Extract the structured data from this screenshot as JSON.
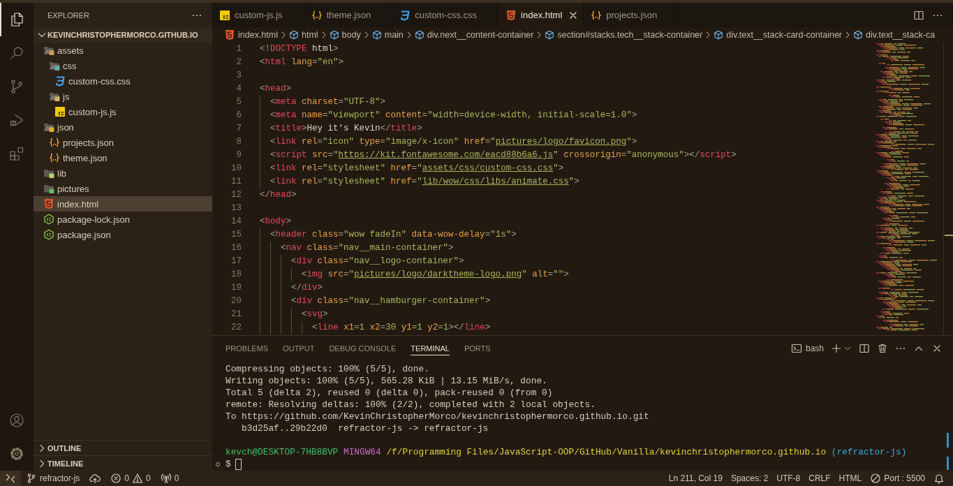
{
  "activity_bar": {
    "items": [
      {
        "kind": "files",
        "selected": true
      },
      {
        "kind": "search",
        "selected": false
      },
      {
        "kind": "source-control",
        "selected": false
      },
      {
        "kind": "run-debug",
        "selected": false
      },
      {
        "kind": "extensions",
        "selected": false
      }
    ],
    "bottom_items": [
      {
        "kind": "account"
      },
      {
        "kind": "settings"
      }
    ]
  },
  "sidebar": {
    "title": "EXPLORER",
    "root": {
      "label": "KEVINCHRISTOPHERMORCO.GITHUB.IO",
      "expanded": true,
      "children": [
        {
          "label": "assets",
          "kind": "folder-assets",
          "expanded": true,
          "selected": false,
          "children": [
            {
              "label": "css",
              "kind": "folder-css",
              "expanded": true,
              "selected": false,
              "children": [
                {
                  "label": "custom-css.css",
                  "kind": "css",
                  "selected": false
                }
              ]
            },
            {
              "label": "js",
              "kind": "folder-js",
              "expanded": true,
              "selected": false,
              "children": [
                {
                  "label": "custom-js.js",
                  "kind": "js",
                  "selected": false
                }
              ]
            }
          ]
        },
        {
          "label": "json",
          "kind": "folder-json",
          "expanded": true,
          "selected": false,
          "children": [
            {
              "label": "projects.json",
              "kind": "json",
              "selected": false
            },
            {
              "label": "theme.json",
              "kind": "json",
              "selected": false
            }
          ]
        },
        {
          "label": "lib",
          "kind": "folder-lib",
          "expanded": false,
          "selected": false
        },
        {
          "label": "pictures",
          "kind": "folder-images",
          "expanded": false,
          "selected": false
        },
        {
          "label": "index.html",
          "kind": "html",
          "selected": true
        },
        {
          "label": "package-lock.json",
          "kind": "npm",
          "selected": false
        },
        {
          "label": "package.json",
          "kind": "npm",
          "selected": false
        }
      ]
    },
    "sections": [
      {
        "label": "OUTLINE",
        "expanded": false
      },
      {
        "label": "TIMELINE",
        "expanded": false
      }
    ]
  },
  "tabs": [
    {
      "label": "custom-js.js",
      "kind": "js",
      "selected": false
    },
    {
      "label": "theme.json",
      "kind": "json",
      "selected": false
    },
    {
      "label": "custom-css.css",
      "kind": "css",
      "selected": false
    },
    {
      "label": "index.html",
      "kind": "html",
      "selected": true
    },
    {
      "label": "projects.json",
      "kind": "json",
      "selected": false
    }
  ],
  "breadcrumbs": [
    {
      "label": "index.html",
      "kind": "html"
    },
    {
      "label": "html",
      "kind": "element"
    },
    {
      "label": "body",
      "kind": "element"
    },
    {
      "label": "main",
      "kind": "element"
    },
    {
      "label": "div.next__content-container",
      "kind": "element"
    },
    {
      "label": "section#stacks.tech__stack-container",
      "kind": "element"
    },
    {
      "label": "div.text__stack-card-container",
      "kind": "element"
    },
    {
      "label": "div.text__stack-ca",
      "kind": "element"
    }
  ],
  "editor": {
    "lines": [
      {
        "number": "1",
        "tokens": [
          {
            "kind": "punct",
            "text": "<!"
          },
          {
            "kind": "tag",
            "text": "DOCTYPE"
          },
          {
            "kind": "text",
            "text": " html"
          },
          {
            "kind": "punct",
            "text": ">"
          }
        ]
      },
      {
        "number": "2",
        "tokens": [
          {
            "kind": "punct",
            "text": "<"
          },
          {
            "kind": "tag",
            "text": "html"
          },
          {
            "kind": "attr",
            "text": " lang"
          },
          {
            "kind": "punct",
            "text": "="
          },
          {
            "kind": "string",
            "text": "\"en\""
          },
          {
            "kind": "punct",
            "text": ">"
          }
        ]
      },
      {
        "number": "3"
      },
      {
        "number": "4",
        "tokens": [
          {
            "kind": "punct",
            "text": "<"
          },
          {
            "kind": "tag",
            "text": "head"
          },
          {
            "kind": "punct",
            "text": ">"
          }
        ]
      },
      {
        "number": "5",
        "tokens": [
          {
            "kind": "punct",
            "text": "  <"
          },
          {
            "kind": "tag",
            "text": "meta"
          },
          {
            "kind": "attr",
            "text": " charset"
          },
          {
            "kind": "punct",
            "text": "="
          },
          {
            "kind": "string",
            "text": "\"UTF-8\""
          },
          {
            "kind": "punct",
            "text": ">"
          }
        ]
      },
      {
        "number": "6",
        "tokens": [
          {
            "kind": "punct",
            "text": "  <"
          },
          {
            "kind": "tag",
            "text": "meta"
          },
          {
            "kind": "attr",
            "text": " name"
          },
          {
            "kind": "punct",
            "text": "="
          },
          {
            "kind": "string",
            "text": "\"viewport\""
          },
          {
            "kind": "attr",
            "text": " content"
          },
          {
            "kind": "punct",
            "text": "="
          },
          {
            "kind": "string",
            "text": "\"width=device-width, initial-scale=1.0\""
          },
          {
            "kind": "punct",
            "text": ">"
          }
        ]
      },
      {
        "number": "7",
        "tokens": [
          {
            "kind": "punct",
            "text": "  <"
          },
          {
            "kind": "tag",
            "text": "title"
          },
          {
            "kind": "punct",
            "text": ">"
          },
          {
            "kind": "text",
            "text": "Hey it's Kevin"
          },
          {
            "kind": "punct",
            "text": "</"
          },
          {
            "kind": "tag",
            "text": "title"
          },
          {
            "kind": "punct",
            "text": ">"
          }
        ]
      },
      {
        "number": "8",
        "tokens": [
          {
            "kind": "punct",
            "text": "  <"
          },
          {
            "kind": "tag",
            "text": "link"
          },
          {
            "kind": "attr",
            "text": " rel"
          },
          {
            "kind": "punct",
            "text": "="
          },
          {
            "kind": "string",
            "text": "\"icon\""
          },
          {
            "kind": "attr",
            "text": " type"
          },
          {
            "kind": "punct",
            "text": "="
          },
          {
            "kind": "string",
            "text": "\"image/x-icon\""
          },
          {
            "kind": "attr",
            "text": " href"
          },
          {
            "kind": "punct",
            "text": "="
          },
          {
            "kind": "string",
            "text": "\""
          },
          {
            "kind": "link",
            "text": "pictures/logo/favicon.png"
          },
          {
            "kind": "string",
            "text": "\""
          },
          {
            "kind": "punct",
            "text": ">"
          }
        ]
      },
      {
        "number": "9",
        "tokens": [
          {
            "kind": "punct",
            "text": "  <"
          },
          {
            "kind": "tag",
            "text": "script"
          },
          {
            "kind": "attr",
            "text": " src"
          },
          {
            "kind": "punct",
            "text": "="
          },
          {
            "kind": "string",
            "text": "\""
          },
          {
            "kind": "link",
            "text": "https://kit.fontawesome.com/eacd88b6a6.js"
          },
          {
            "kind": "string",
            "text": "\""
          },
          {
            "kind": "attr",
            "text": " crossorigin"
          },
          {
            "kind": "punct",
            "text": "="
          },
          {
            "kind": "string",
            "text": "\"anonymous\""
          },
          {
            "kind": "punct",
            "text": "></"
          },
          {
            "kind": "tag",
            "text": "script"
          },
          {
            "kind": "punct",
            "text": ">"
          }
        ]
      },
      {
        "number": "10",
        "tokens": [
          {
            "kind": "punct",
            "text": "  <"
          },
          {
            "kind": "tag",
            "text": "link"
          },
          {
            "kind": "attr",
            "text": " rel"
          },
          {
            "kind": "punct",
            "text": "="
          },
          {
            "kind": "string",
            "text": "\"stylesheet\""
          },
          {
            "kind": "attr",
            "text": " href"
          },
          {
            "kind": "punct",
            "text": "="
          },
          {
            "kind": "string",
            "text": "\""
          },
          {
            "kind": "link",
            "text": "assets/css/custom-css.css"
          },
          {
            "kind": "string",
            "text": "\""
          },
          {
            "kind": "punct",
            "text": ">"
          }
        ]
      },
      {
        "number": "11",
        "tokens": [
          {
            "kind": "punct",
            "text": "  <"
          },
          {
            "kind": "tag",
            "text": "link"
          },
          {
            "kind": "attr",
            "text": " rel"
          },
          {
            "kind": "punct",
            "text": "="
          },
          {
            "kind": "string",
            "text": "\"stylesheet\""
          },
          {
            "kind": "attr",
            "text": " href"
          },
          {
            "kind": "punct",
            "text": "="
          },
          {
            "kind": "string",
            "text": "\""
          },
          {
            "kind": "link",
            "text": "lib/wow/css/libs/animate.css"
          },
          {
            "kind": "string",
            "text": "\""
          },
          {
            "kind": "punct",
            "text": ">"
          }
        ]
      },
      {
        "number": "12",
        "tokens": [
          {
            "kind": "punct",
            "text": "</"
          },
          {
            "kind": "tag",
            "text": "head"
          },
          {
            "kind": "punct",
            "text": ">"
          }
        ]
      },
      {
        "number": "13"
      },
      {
        "number": "14",
        "tokens": [
          {
            "kind": "punct",
            "text": "<"
          },
          {
            "kind": "tag",
            "text": "body"
          },
          {
            "kind": "punct",
            "text": ">"
          }
        ]
      },
      {
        "number": "15",
        "tokens": [
          {
            "kind": "punct",
            "text": "  <"
          },
          {
            "kind": "tag",
            "text": "header"
          },
          {
            "kind": "attr",
            "text": " class"
          },
          {
            "kind": "punct",
            "text": "="
          },
          {
            "kind": "string",
            "text": "\"wow fadeIn\""
          },
          {
            "kind": "attr",
            "text": " data-wow-delay"
          },
          {
            "kind": "punct",
            "text": "="
          },
          {
            "kind": "string",
            "text": "\"1s\""
          },
          {
            "kind": "punct",
            "text": ">"
          }
        ]
      },
      {
        "number": "16",
        "tokens": [
          {
            "kind": "punct",
            "text": "    <"
          },
          {
            "kind": "tag",
            "text": "nav"
          },
          {
            "kind": "attr",
            "text": " class"
          },
          {
            "kind": "punct",
            "text": "="
          },
          {
            "kind": "string",
            "text": "\"nav__main-container\""
          },
          {
            "kind": "punct",
            "text": ">"
          }
        ]
      },
      {
        "number": "17",
        "tokens": [
          {
            "kind": "punct",
            "text": "      <"
          },
          {
            "kind": "tag",
            "text": "div"
          },
          {
            "kind": "attr",
            "text": " class"
          },
          {
            "kind": "punct",
            "text": "="
          },
          {
            "kind": "string",
            "text": "\"nav__logo-container\""
          },
          {
            "kind": "punct",
            "text": ">"
          }
        ]
      },
      {
        "number": "18",
        "tokens": [
          {
            "kind": "punct",
            "text": "        <"
          },
          {
            "kind": "tag",
            "text": "img"
          },
          {
            "kind": "attr",
            "text": " src"
          },
          {
            "kind": "punct",
            "text": "="
          },
          {
            "kind": "string",
            "text": "\""
          },
          {
            "kind": "link",
            "text": "pictures/logo/darktheme-logo.png"
          },
          {
            "kind": "string",
            "text": "\""
          },
          {
            "kind": "attr",
            "text": " alt"
          },
          {
            "kind": "punct",
            "text": "="
          },
          {
            "kind": "string",
            "text": "\"\""
          },
          {
            "kind": "punct",
            "text": ">"
          }
        ]
      },
      {
        "number": "19",
        "tokens": [
          {
            "kind": "punct",
            "text": "      </"
          },
          {
            "kind": "tag",
            "text": "div"
          },
          {
            "kind": "punct",
            "text": ">"
          }
        ]
      },
      {
        "number": "20",
        "tokens": [
          {
            "kind": "punct",
            "text": "      <"
          },
          {
            "kind": "tag",
            "text": "div"
          },
          {
            "kind": "attr",
            "text": " class"
          },
          {
            "kind": "punct",
            "text": "="
          },
          {
            "kind": "string",
            "text": "\"nav__hamburger-container\""
          },
          {
            "kind": "punct",
            "text": ">"
          }
        ]
      },
      {
        "number": "21",
        "tokens": [
          {
            "kind": "punct",
            "text": "        <"
          },
          {
            "kind": "tag",
            "text": "svg"
          },
          {
            "kind": "punct",
            "text": ">"
          }
        ]
      },
      {
        "number": "22",
        "tokens": [
          {
            "kind": "punct",
            "text": "          <"
          },
          {
            "kind": "tag",
            "text": "line"
          },
          {
            "kind": "attr",
            "text": " x1"
          },
          {
            "kind": "punct",
            "text": "="
          },
          {
            "kind": "string",
            "text": "1"
          },
          {
            "kind": "attr",
            "text": " x2"
          },
          {
            "kind": "punct",
            "text": "="
          },
          {
            "kind": "string",
            "text": "30"
          },
          {
            "kind": "attr",
            "text": " y1"
          },
          {
            "kind": "punct",
            "text": "="
          },
          {
            "kind": "string",
            "text": "1"
          },
          {
            "kind": "attr",
            "text": " y2"
          },
          {
            "kind": "punct",
            "text": "="
          },
          {
            "kind": "string",
            "text": "1"
          },
          {
            "kind": "punct",
            "text": "></"
          },
          {
            "kind": "tag",
            "text": "line"
          },
          {
            "kind": "punct",
            "text": ">"
          }
        ]
      }
    ]
  },
  "panel": {
    "tabs": [
      {
        "label": "PROBLEMS",
        "selected": false
      },
      {
        "label": "OUTPUT",
        "selected": false
      },
      {
        "label": "DEBUG CONSOLE",
        "selected": false
      },
      {
        "label": "TERMINAL",
        "selected": true
      },
      {
        "label": "PORTS",
        "selected": false
      }
    ],
    "shell": "bash",
    "terminal": {
      "lines": [
        {
          "kind": "output",
          "text": "Compressing objects: 100% (5/5), done."
        },
        {
          "kind": "output",
          "text": "Writing objects: 100% (5/5), 565.28 KiB | 13.15 MiB/s, done."
        },
        {
          "kind": "output",
          "text": "Total 5 (delta 2), reused 0 (delta 0), pack-reused 0 (from 0)"
        },
        {
          "kind": "output",
          "text": "remote: Resolving deltas: 100% (2/2), completed with 2 local objects."
        },
        {
          "kind": "output",
          "text": "To https://github.com/KevinChristopherMorco/kevinchristophermorco.github.io.git"
        },
        {
          "kind": "output",
          "text": "   b3d25af..29b22d0  refractor-js -> refractor-js"
        },
        {
          "kind": "blank"
        },
        {
          "kind": "prompt",
          "segments": [
            {
              "kind": "user",
              "text": "kevch@DESKTOP-7HB8BVP"
            },
            {
              "kind": "system",
              "text": "MINGW64"
            },
            {
              "kind": "path",
              "text": "/f/Programming Files/JavaScript-OOP/GitHub/Vanilla/kevinchristophermorco.github.io"
            },
            {
              "kind": "branch",
              "text": "(refractor-js)"
            }
          ]
        },
        {
          "kind": "input",
          "text": "$"
        }
      ]
    }
  },
  "status_bar": {
    "left": [
      {
        "kind": "remote"
      },
      {
        "kind": "branch",
        "text": "refractor-js"
      },
      {
        "kind": "publish"
      },
      {
        "kind": "problems",
        "errors": "0",
        "warnings": "0"
      },
      {
        "kind": "ports",
        "text": "0"
      }
    ],
    "right": [
      {
        "kind": "text",
        "text": "Ln 211, Col 19"
      },
      {
        "kind": "text",
        "text": "Spaces: 2"
      },
      {
        "kind": "text",
        "text": "UTF-8"
      },
      {
        "kind": "text",
        "text": "CRLF"
      },
      {
        "kind": "text",
        "text": "HTML"
      },
      {
        "kind": "live-server",
        "text": "Port : 5500"
      },
      {
        "kind": "notifications"
      }
    ]
  }
}
